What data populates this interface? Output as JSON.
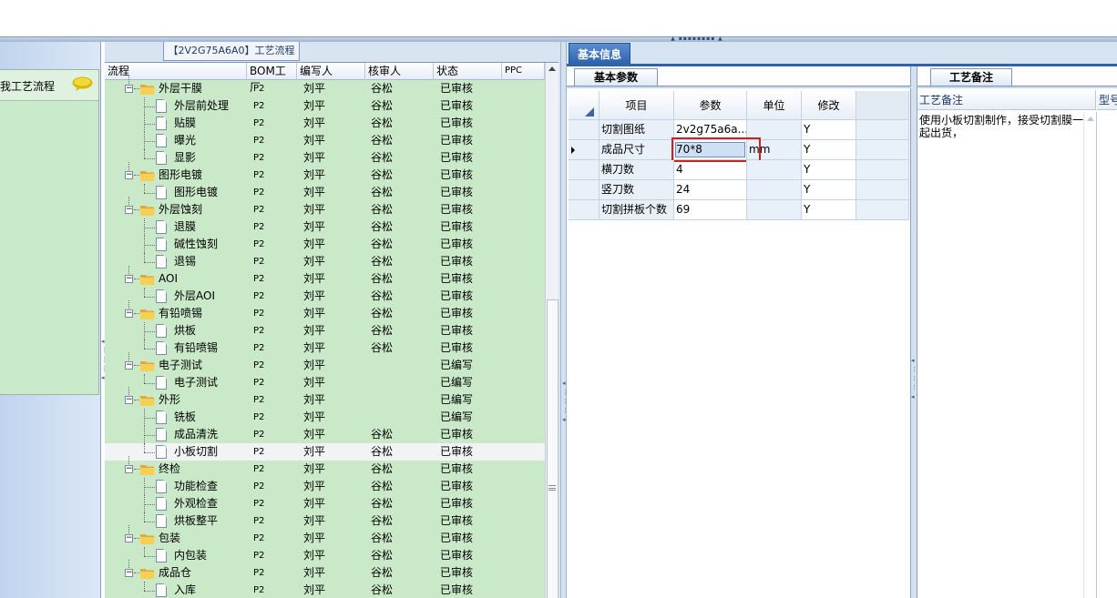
{
  "left_panel": {
    "title": "我工艺流程",
    "chat_icon": "speech-bubble-icon"
  },
  "process_panel": {
    "tab_label": "【2V2G75A6A0】工艺流程",
    "columns": [
      "流程",
      "BOM工厂",
      "编写人",
      "核审人",
      "状态",
      "PPC"
    ],
    "rows": [
      {
        "name": "外层干膜",
        "level": 0,
        "bom": "P2",
        "author": "刘平",
        "reviewer": "谷松",
        "status": "已审核"
      },
      {
        "name": "外层前处理",
        "level": 1,
        "bom": "P2",
        "author": "刘平",
        "reviewer": "谷松",
        "status": "已审核"
      },
      {
        "name": "贴膜",
        "level": 1,
        "bom": "P2",
        "author": "刘平",
        "reviewer": "谷松",
        "status": "已审核"
      },
      {
        "name": "曝光",
        "level": 1,
        "bom": "P2",
        "author": "刘平",
        "reviewer": "谷松",
        "status": "已审核"
      },
      {
        "name": "显影",
        "level": 1,
        "bom": "P2",
        "author": "刘平",
        "reviewer": "谷松",
        "status": "已审核"
      },
      {
        "name": "图形电镀",
        "level": 0,
        "bom": "P2",
        "author": "刘平",
        "reviewer": "谷松",
        "status": "已审核"
      },
      {
        "name": "图形电镀",
        "level": 1,
        "bom": "P2",
        "author": "刘平",
        "reviewer": "谷松",
        "status": "已审核"
      },
      {
        "name": "外层蚀刻",
        "level": 0,
        "bom": "P2",
        "author": "刘平",
        "reviewer": "谷松",
        "status": "已审核"
      },
      {
        "name": "退膜",
        "level": 1,
        "bom": "P2",
        "author": "刘平",
        "reviewer": "谷松",
        "status": "已审核"
      },
      {
        "name": "碱性蚀刻",
        "level": 1,
        "bom": "P2",
        "author": "刘平",
        "reviewer": "谷松",
        "status": "已审核"
      },
      {
        "name": "退锡",
        "level": 1,
        "bom": "P2",
        "author": "刘平",
        "reviewer": "谷松",
        "status": "已审核"
      },
      {
        "name": "AOI",
        "level": 0,
        "bom": "P2",
        "author": "刘平",
        "reviewer": "谷松",
        "status": "已审核"
      },
      {
        "name": "外层AOI",
        "level": 1,
        "bom": "P2",
        "author": "刘平",
        "reviewer": "谷松",
        "status": "已审核"
      },
      {
        "name": "有铅喷锡",
        "level": 0,
        "bom": "P2",
        "author": "刘平",
        "reviewer": "谷松",
        "status": "已审核"
      },
      {
        "name": "烘板",
        "level": 1,
        "bom": "P2",
        "author": "刘平",
        "reviewer": "谷松",
        "status": "已审核"
      },
      {
        "name": "有铅喷锡",
        "level": 1,
        "bom": "P2",
        "author": "刘平",
        "reviewer": "谷松",
        "status": "已审核"
      },
      {
        "name": "电子测试",
        "level": 0,
        "bom": "P2",
        "author": "刘平",
        "reviewer": "",
        "status": "已编写"
      },
      {
        "name": "电子测试",
        "level": 1,
        "bom": "P2",
        "author": "刘平",
        "reviewer": "",
        "status": "已编写"
      },
      {
        "name": "外形",
        "level": 0,
        "bom": "P2",
        "author": "刘平",
        "reviewer": "",
        "status": "已编写"
      },
      {
        "name": "铣板",
        "level": 1,
        "bom": "P2",
        "author": "刘平",
        "reviewer": "",
        "status": "已编写"
      },
      {
        "name": "成品清洗",
        "level": 1,
        "bom": "P2",
        "author": "刘平",
        "reviewer": "谷松",
        "status": "已审核"
      },
      {
        "name": "小板切割",
        "level": 1,
        "bom": "P2",
        "author": "刘平",
        "reviewer": "谷松",
        "status": "已审核",
        "selected": true
      },
      {
        "name": "终检",
        "level": 0,
        "bom": "P2",
        "author": "刘平",
        "reviewer": "谷松",
        "status": "已审核"
      },
      {
        "name": "功能检查",
        "level": 1,
        "bom": "P2",
        "author": "刘平",
        "reviewer": "谷松",
        "status": "已审核"
      },
      {
        "name": "外观检查",
        "level": 1,
        "bom": "P2",
        "author": "刘平",
        "reviewer": "谷松",
        "status": "已审核"
      },
      {
        "name": "烘板整平",
        "level": 1,
        "bom": "P2",
        "author": "刘平",
        "reviewer": "谷松",
        "status": "已审核"
      },
      {
        "name": "包装",
        "level": 0,
        "bom": "P2",
        "author": "刘平",
        "reviewer": "谷松",
        "status": "已审核"
      },
      {
        "name": "内包装",
        "level": 1,
        "bom": "P2",
        "author": "刘平",
        "reviewer": "谷松",
        "status": "已审核"
      },
      {
        "name": "成品仓",
        "level": 0,
        "bom": "P2",
        "author": "刘平",
        "reviewer": "谷松",
        "status": "已审核"
      },
      {
        "name": "入库",
        "level": 1,
        "bom": "P2",
        "author": "刘平",
        "reviewer": "谷松",
        "status": "已审核"
      }
    ]
  },
  "basic_info": {
    "tab_label": "基本信息",
    "params_tab_label": "基本参数",
    "columns": [
      "项目",
      "参数",
      "单位",
      "修改"
    ],
    "rows": [
      {
        "item": "切割图纸",
        "value": "2v2g75a6a...",
        "unit": "",
        "modified": "Y"
      },
      {
        "item": "成品尺寸",
        "value": "70*8",
        "unit": "mm",
        "modified": "Y",
        "selected": true
      },
      {
        "item": "横刀数",
        "value": "4",
        "unit": "",
        "modified": "Y"
      },
      {
        "item": "竖刀数",
        "value": "24",
        "unit": "",
        "modified": "Y"
      },
      {
        "item": "切割拼板个数",
        "value": "69",
        "unit": "",
        "modified": "Y"
      }
    ]
  },
  "notes": {
    "tab_label": "工艺备注",
    "column_label": "工艺备注",
    "column2_label": "型号",
    "text": "使用小板切割制作，接受切割膜一起出货，"
  },
  "colors": {
    "tree_bg": "#c9e9c8",
    "accent_tab": "#2e63ad",
    "highlight_box": "#d41f1f"
  }
}
